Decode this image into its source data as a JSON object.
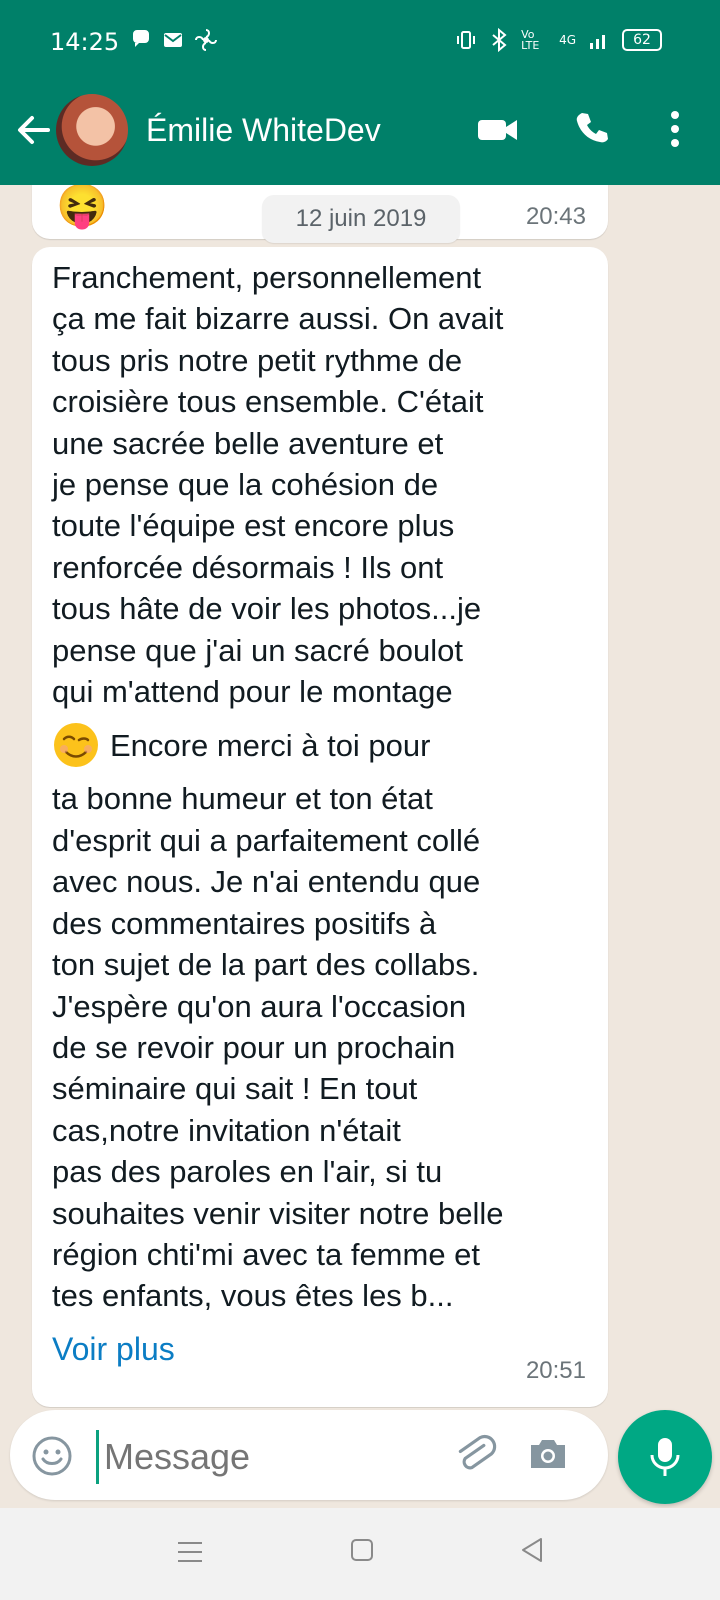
{
  "status_bar": {
    "time": "14:25",
    "battery": "62",
    "network": "4G",
    "volte": "Vo LTE"
  },
  "header": {
    "contact_name": "Émilie WhiteDev"
  },
  "chat": {
    "date_separator": "12 juin 2019",
    "previous_message": {
      "emoji": "😝",
      "time": "20:43"
    },
    "message": {
      "lines_before_emoji": [
        "Franchement, personnellement",
        "ça me fait bizarre aussi. On avait",
        "tous pris notre petit rythme de",
        "croisière tous ensemble. C'était",
        "une sacrée belle aventure et",
        "je pense que la cohésion de",
        "toute l'équipe est encore plus",
        "renforcée désormais ! Ils ont",
        "tous hâte de voir les photos...je",
        "pense que j'ai un sacré boulot",
        "qui m'attend pour le montage"
      ],
      "emoji_line_text": "Encore merci à toi pour",
      "lines_after_emoji": [
        "ta bonne humeur et ton état",
        "d'esprit qui a parfaitement collé",
        "avec nous. Je n'ai entendu que",
        "des commentaires positifs à",
        "ton sujet de la part des collabs.",
        "J'espère qu'on aura l'occasion",
        "de se revoir pour un prochain",
        "séminaire qui sait ! En tout",
        "cas,notre invitation n'était",
        "pas des paroles en l'air, si tu",
        "souhaites venir visiter notre belle",
        "région chti'mi avec ta femme et",
        "tes enfants, vous êtes les b..."
      ],
      "read_more": "Voir plus",
      "time": "20:51"
    }
  },
  "composer": {
    "placeholder": "Message"
  },
  "colors": {
    "header_green": "#008069",
    "accent_green": "#00a884",
    "chat_background": "#efe7de",
    "link_blue": "#0b7dc4"
  },
  "icons": [
    "back-arrow-icon",
    "video-call-icon",
    "phone-icon",
    "more-options-icon",
    "emoji-icon",
    "attach-icon",
    "camera-icon",
    "mic-icon",
    "double-chevron-down-icon",
    "nav-menu-icon",
    "nav-home-icon",
    "nav-back-icon"
  ]
}
